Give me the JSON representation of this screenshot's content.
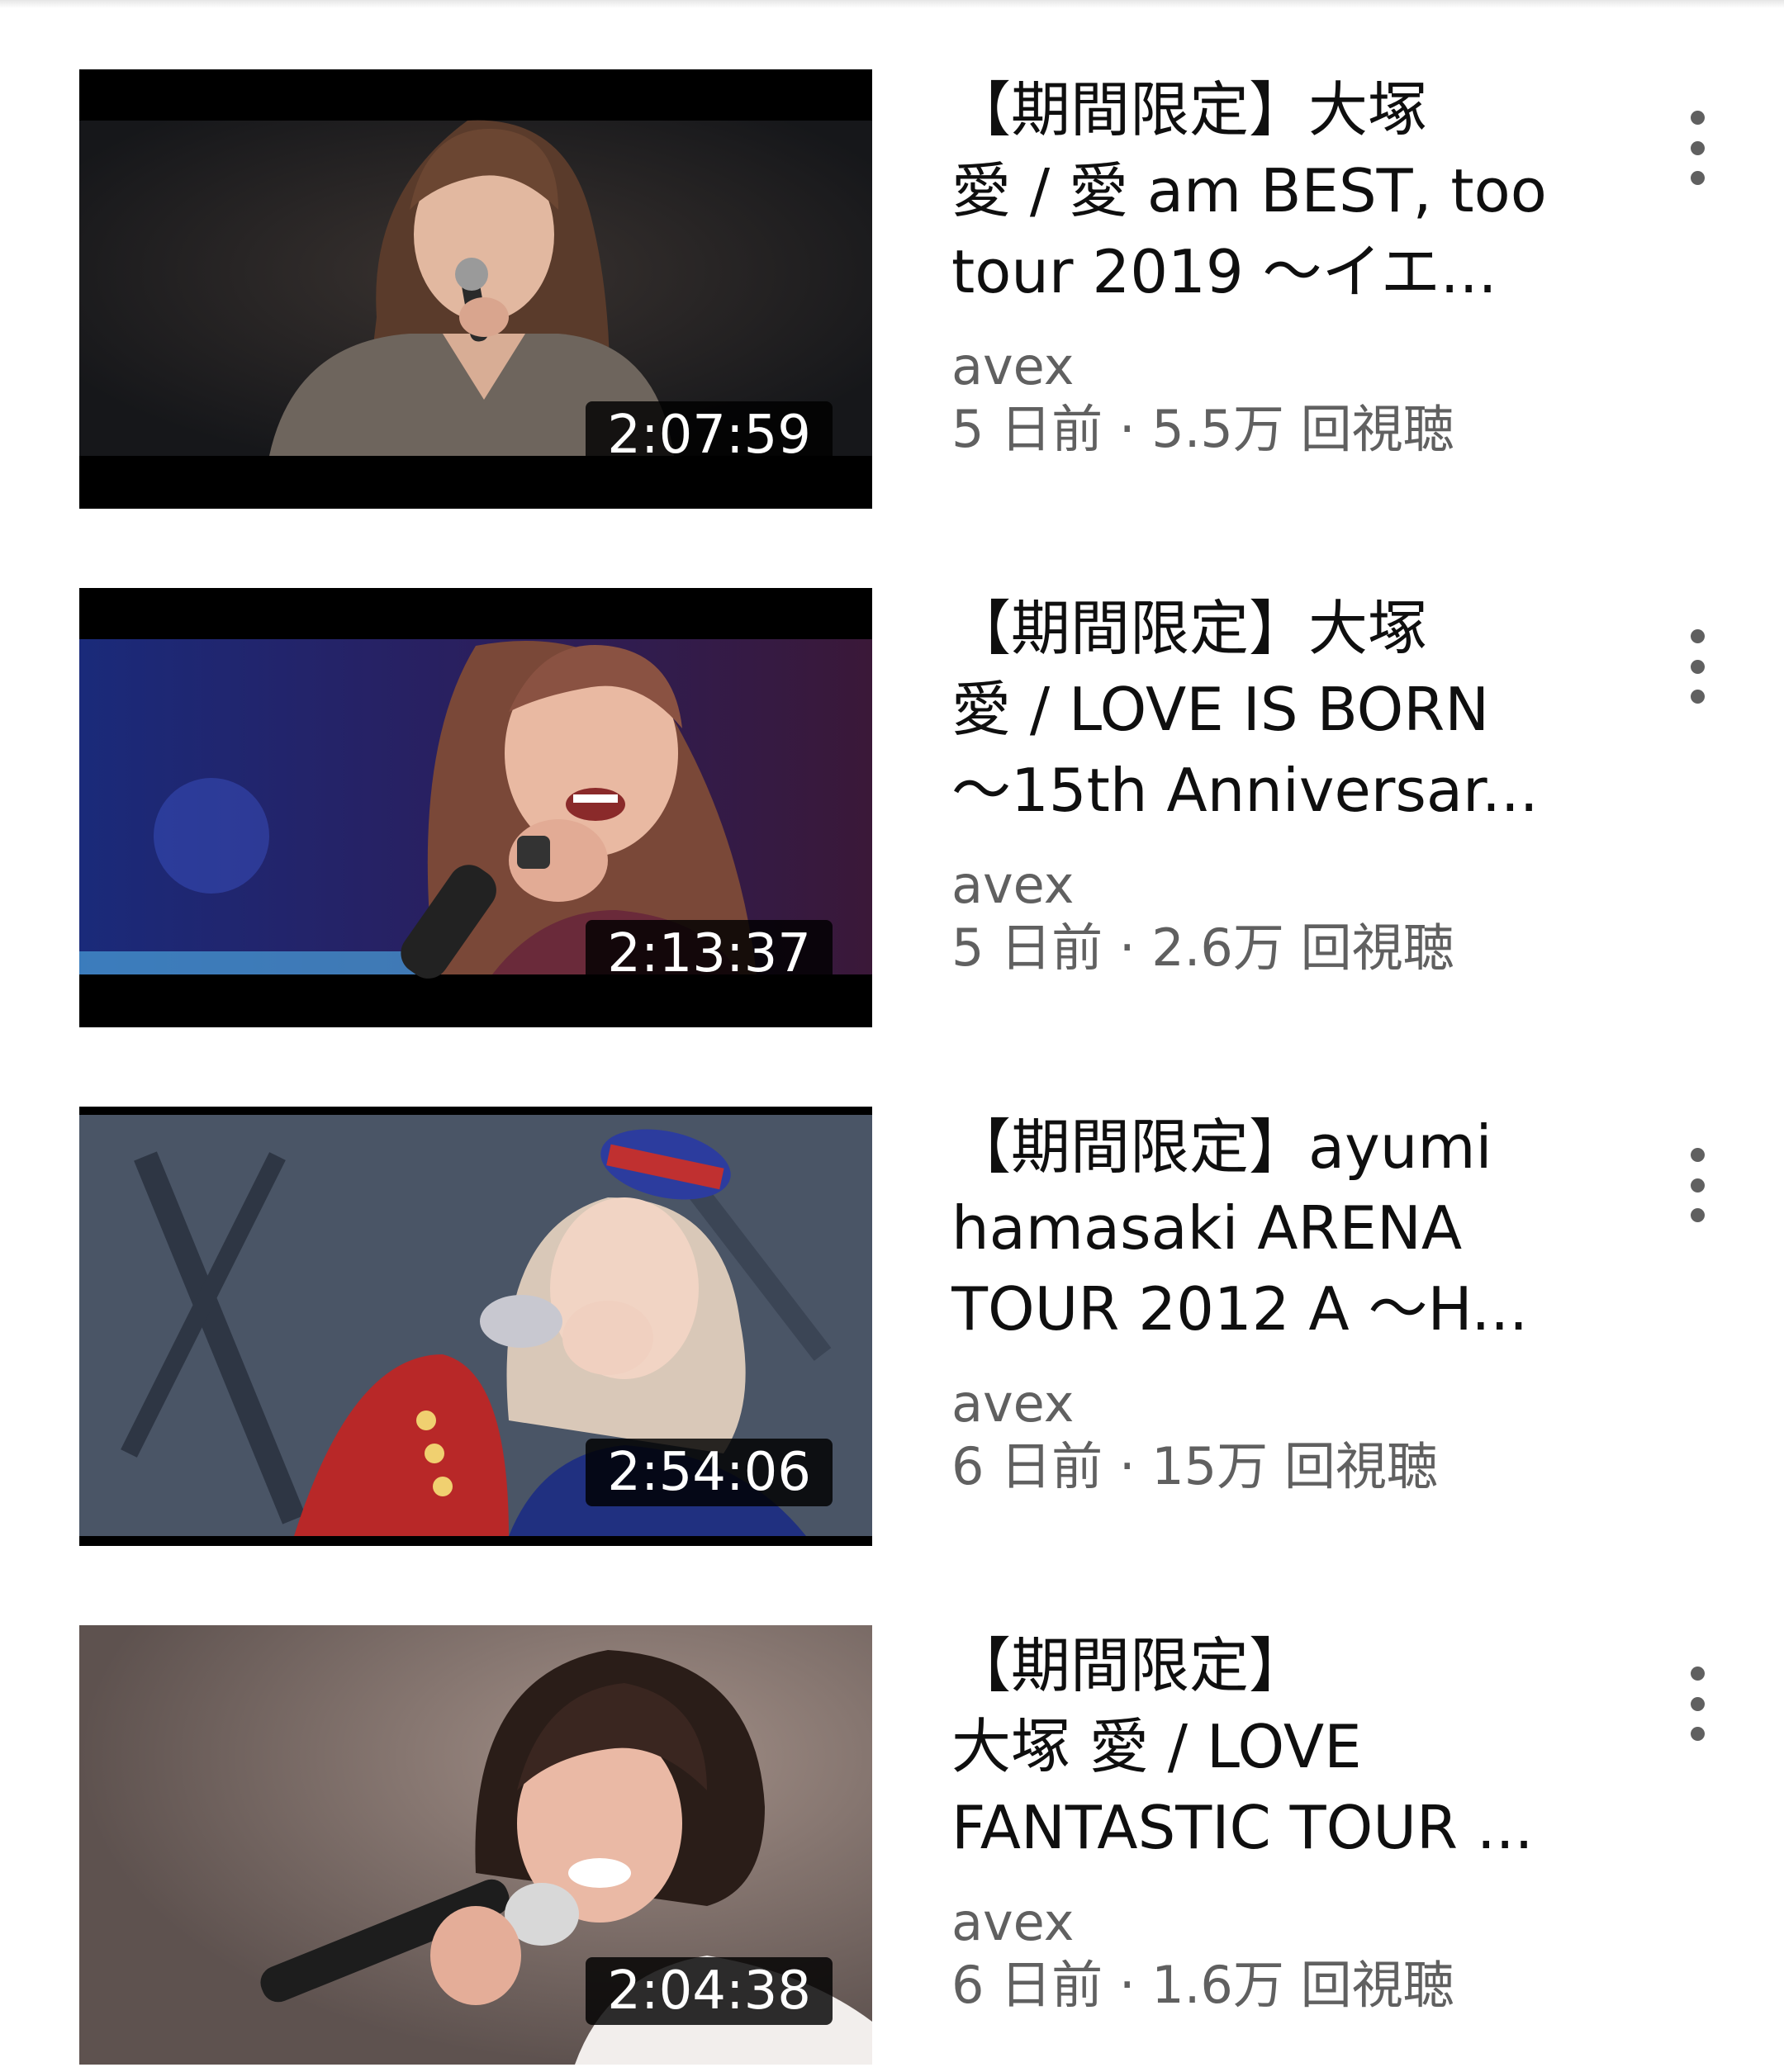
{
  "videos": [
    {
      "title_lines": [
        "【期間限定】大塚",
        "愛 / 愛 am BEST, too",
        "tour 2019 ～イエ..."
      ],
      "channel": "avex",
      "meta": "5 日前 · 5.5万 回視聴",
      "duration": "2:07:59",
      "thumbnail": "woman-with-microphone-dark-stage",
      "menu_icon": "more-vert-icon"
    },
    {
      "title_lines": [
        "【期間限定】大塚",
        "愛 / LOVE IS BORN",
        "～15th Anniversar..."
      ],
      "channel": "avex",
      "meta": "5 日前 · 2.6万 回視聴",
      "duration": "2:13:37",
      "thumbnail": "woman-singing-blue-stage",
      "menu_icon": "more-vert-icon"
    },
    {
      "title_lines": [
        "【期間限定】ayumi",
        "hamasaki ARENA",
        "TOUR 2012 A ～H..."
      ],
      "channel": "avex",
      "meta": "6 日前 · 15万 回視聴",
      "duration": "2:54:06",
      "thumbnail": "woman-in-marching-costume-singing",
      "menu_icon": "more-vert-icon"
    },
    {
      "title_lines": [
        "【期間限定】",
        "大塚 愛 / LOVE",
        "FANTASTIC TOUR ..."
      ],
      "channel": "avex",
      "meta": "6 日前 · 1.6万 回視聴",
      "duration": "2:04:38",
      "thumbnail": "woman-smiling-with-microphone",
      "menu_icon": "more-vert-icon"
    }
  ],
  "colors": {
    "title": "#0f0f0f",
    "secondary": "#606060",
    "background": "#ffffff",
    "duration_bg": "#000000"
  }
}
